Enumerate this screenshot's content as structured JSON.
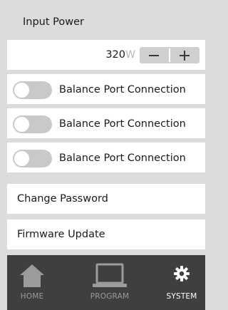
{
  "settings": {
    "header": "Input Power",
    "power": {
      "value": "320",
      "unit": "W",
      "minus_icon": "minus-icon",
      "plus_icon": "plus-icon"
    },
    "toggles": [
      {
        "label": "Balance Port Connection",
        "enabled": false
      },
      {
        "label": "Balance Port Connection",
        "enabled": false
      },
      {
        "label": "Balance Port Connection",
        "enabled": false
      }
    ],
    "links": [
      "Change Password",
      "Firmware Update"
    ]
  },
  "nav": {
    "items": [
      {
        "label": "HOME",
        "icon": "home-icon",
        "active": false
      },
      {
        "label": "PROGRAM",
        "icon": "laptop-icon",
        "active": false
      },
      {
        "label": "SYSTEM",
        "icon": "gear-icon",
        "active": true
      }
    ]
  },
  "colors": {
    "background": "#dcdcdd",
    "row": "#ffffff",
    "toggle_off": "#c9c9ca",
    "nav_bg": "#3f3f41",
    "nav_inactive": "#9b9b9c",
    "nav_active": "#ffffff"
  }
}
